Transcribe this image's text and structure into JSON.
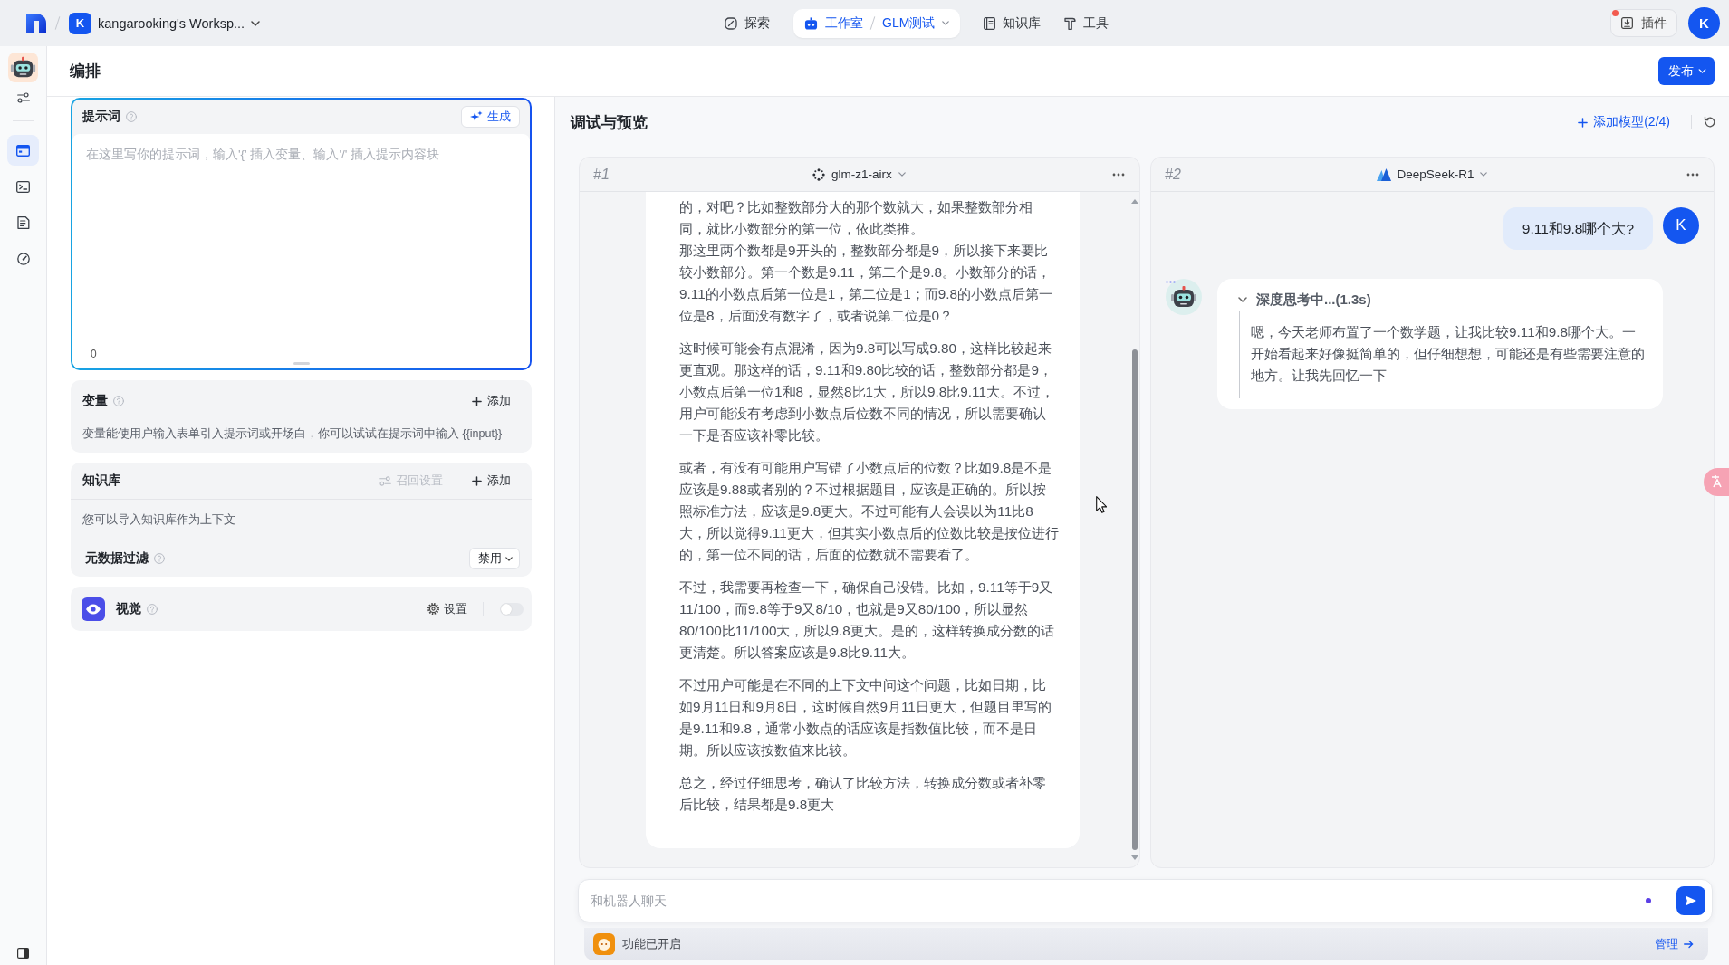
{
  "topbar": {
    "workspace": {
      "badge": "K",
      "name": "kangarooking's Worksp..."
    },
    "nav": [
      {
        "kind": "explore",
        "label": "探索",
        "selected": false
      },
      {
        "kind": "studio",
        "label": "工作室",
        "project": "GLM测试",
        "selected": true
      },
      {
        "kind": "knowledge",
        "label": "知识库",
        "selected": false
      },
      {
        "kind": "tools",
        "label": "工具",
        "selected": false
      }
    ],
    "plugins": {
      "label": "插件",
      "notification": true
    },
    "avatar": "K"
  },
  "sidebar": {
    "items": [
      {
        "kind": "settings",
        "selected": false
      },
      {
        "kind": "layout",
        "selected": true
      },
      {
        "kind": "terminal",
        "selected": false
      },
      {
        "kind": "document",
        "selected": false
      },
      {
        "kind": "gauge",
        "selected": false
      }
    ]
  },
  "editor": {
    "title": "编排",
    "publish": "发布",
    "prompt": {
      "title": "提示词",
      "generate": "生成",
      "placeholder": "在这里写你的提示词，输入'{' 插入变量、输入'/' 插入提示内容块",
      "count": "0",
      "focused": true
    },
    "variables": {
      "title": "变量",
      "add": "添加",
      "description": "变量能使用户输入表单引入提示词或开场白，你可以试试在提示词中输入 {{input}}"
    },
    "knowledge": {
      "title": "知识库",
      "recall": {
        "label": "召回设置",
        "disabled": true
      },
      "add": "添加",
      "description": "您可以导入知识库作为上下文",
      "filter": {
        "label": "元数据过滤",
        "value": "禁用"
      }
    },
    "vision": {
      "title": "视觉",
      "settings": "设置",
      "on": false
    }
  },
  "preview": {
    "title": "调试与预览",
    "add_model": "添加模型(2/4)",
    "columns": [
      {
        "index": "#1",
        "model": "glm-z1-airx",
        "scrollable": true,
        "messages": [
          {
            "kind": "thinking",
            "paragraphs": [
              [
                "的，对吧？比如整数部分大的那个数就大，如果整数部分相同，就比小数部分的第一位，依此类推。",
                "那这里两个数都是9开头的，整数部分都是9，所以接下来要比较小数部分。第一个数是9.11，第二个是9.8。小数部分的话，9.11的小数点后第一位是1，第二位是1；而9.8的小数点后第一位是8，后面没有数字了，或者说第二位是0？"
              ],
              [
                "这时候可能会有点混淆，因为9.8可以写成9.80，这样比较起来更直观。那这样的话，9.11和9.80比较的话，整数部分都是9，小数点后第一位1和8，显然8比1大，所以9.8比9.11大。不过，用户可能没有考虑到小数点后位数不同的情况，所以需要确认一下是否应该补零比较。"
              ],
              [
                "或者，有没有可能用户写错了小数点后的位数？比如9.8是不是应该是9.88或者别的？不过根据题目，应该是正确的。所以按照标准方法，应该是9.8更大。不过可能有人会误以为11比8大，所以觉得9.11更大，但其实小数点后的位数比较是按位进行的，第一位不同的话，后面的位数就不需要看了。"
              ],
              [
                "不过，我需要再检查一下，确保自己没错。比如，9.11等于9又11/100，而9.8等于9又8/10，也就是9又80/100，所以显然80/100比11/100大，所以9.8更大。是的，这样转换成分数的话更清楚。所以答案应该是9.8比9.11大。"
              ],
              [
                "不过用户可能是在不同的上下文中问这个问题，比如日期，比如9月11日和9月8日，这时候自然9月11日更大，但题目里写的是9.11和9.8，通常小数点的话应该是指数值比较，而不是日期。所以应该按数值来比较。"
              ],
              [
                "总之，经过仔细思考，确认了比较方法，转换成分数或者补零后比较，结果都是9.8更大"
              ]
            ]
          }
        ]
      },
      {
        "index": "#2",
        "model": "DeepSeek-R1",
        "scrollable": false,
        "messages": [
          {
            "kind": "user",
            "avatar": "K",
            "text": "9.11和9.8哪个大?"
          },
          {
            "kind": "thinking",
            "title": "深度思考中...(1.3s)",
            "expanded": true,
            "paragraphs": [
              [
                "嗯，今天老师布置了一个数学题，让我比较9.11和9.8哪个大。一开始看起来好像挺简单的，但仔细想想，可能还是有些需要注意的地方。让我先回忆一下"
              ]
            ]
          }
        ]
      }
    ],
    "input": {
      "placeholder": "和机器人聊天"
    },
    "features": {
      "label": "功能已开启",
      "manage": "管理"
    }
  }
}
